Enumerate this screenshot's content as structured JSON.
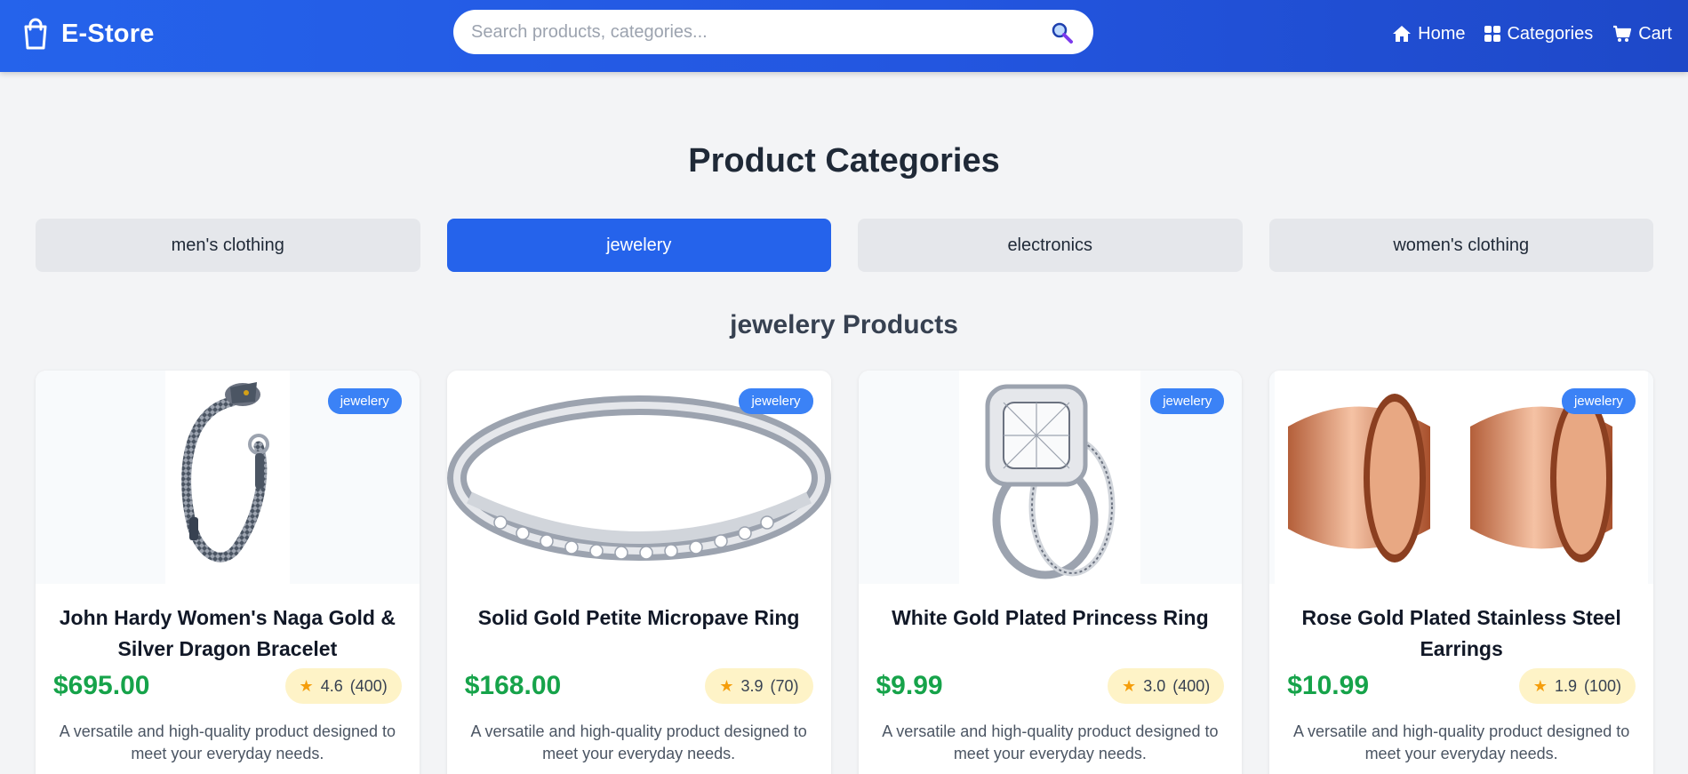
{
  "header": {
    "brand": "E-Store",
    "search": {
      "placeholder": "Search products, categories...",
      "value": ""
    },
    "nav": [
      {
        "label": "Home",
        "icon": "home-icon"
      },
      {
        "label": "Categories",
        "icon": "grid-icon"
      },
      {
        "label": "Cart",
        "icon": "cart-icon"
      }
    ]
  },
  "page": {
    "title": "Product Categories",
    "categories": [
      {
        "label": "men's clothing",
        "active": false
      },
      {
        "label": "jewelery",
        "active": true
      },
      {
        "label": "electronics",
        "active": false
      },
      {
        "label": "women's clothing",
        "active": false
      }
    ],
    "section_title": "jewelery Products"
  },
  "products": [
    {
      "title": "John Hardy Women's Naga Gold & Silver Dragon Bracelet",
      "category": "jewelery",
      "price": "$695.00",
      "rating": "4.6",
      "rating_count": "(400)",
      "description": "A versatile and high-quality product designed to meet your everyday needs.",
      "image": "bracelet-image"
    },
    {
      "title": "Solid Gold Petite Micropave Ring",
      "category": "jewelery",
      "price": "$168.00",
      "rating": "3.9",
      "rating_count": "(70)",
      "description": "A versatile and high-quality product designed to meet your everyday needs.",
      "image": "ring-image"
    },
    {
      "title": "White Gold Plated Princess Ring",
      "category": "jewelery",
      "price": "$9.99",
      "rating": "3.0",
      "rating_count": "(400)",
      "description": "A versatile and high-quality product designed to meet your everyday needs.",
      "image": "princess-ring-image"
    },
    {
      "title": "Rose Gold Plated Stainless Steel Earrings",
      "category": "jewelery",
      "price": "$10.99",
      "rating": "1.9",
      "rating_count": "(100)",
      "description": "A versatile and high-quality product designed to meet your everyday needs.",
      "image": "earrings-image"
    }
  ],
  "colors": {
    "header": "#2563eb",
    "active_category": "#2563eb",
    "badge": "#3b82f6",
    "price": "#16a34a",
    "rating_bg": "#fef3c7",
    "star": "#f59e0b"
  }
}
